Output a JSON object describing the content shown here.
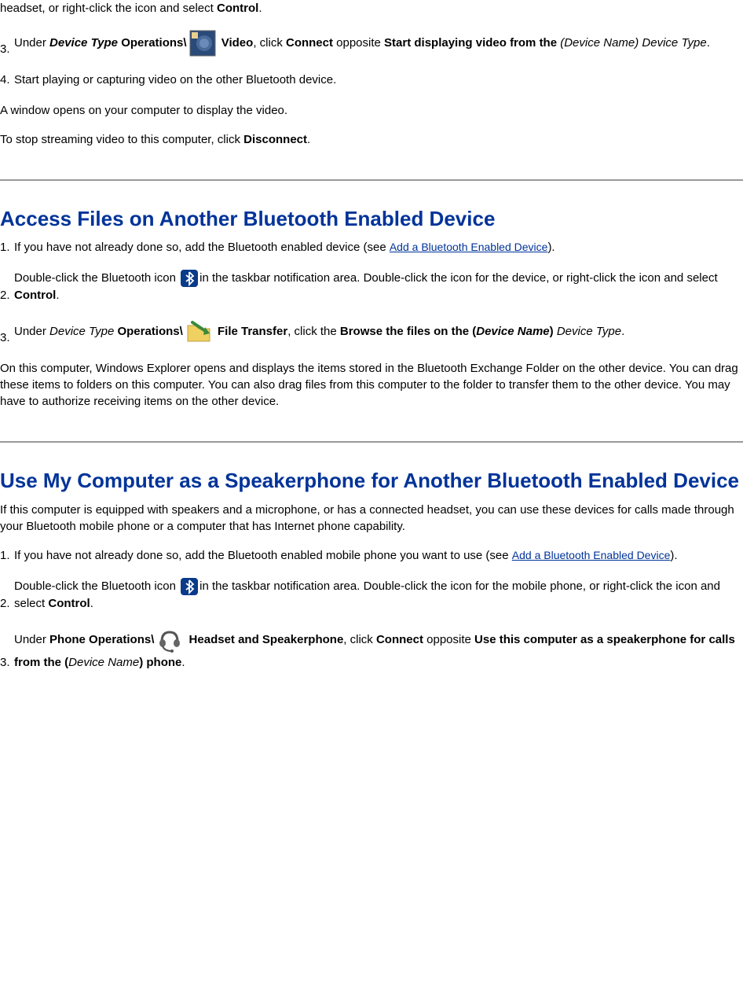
{
  "section1": {
    "topFragment": "headset, or right-click the icon and select ",
    "controlWord": "Control",
    "item3": {
      "num": "3.",
      "preText": "Under ",
      "deviceType": "Device Type",
      "operations": " Operations\\",
      "videoLabel": " Video",
      "clickText": ", click ",
      "connect": "Connect",
      "oppositeText": " opposite ",
      "startDisplay": "Start displaying video from the ",
      "deviceName": "(Device Name) Device Type",
      "period": "."
    },
    "item4": {
      "num": "4.",
      "text": "Start playing or capturing video on the other Bluetooth device."
    },
    "para1": "A window opens on your computer to display the video.",
    "para2_pre": "To stop streaming video to this computer, click ",
    "para2_disconnect": "Disconnect",
    "para2_post": "."
  },
  "section2": {
    "heading": "Access Files on Another Bluetooth Enabled Device",
    "item1": {
      "num": "1.",
      "pre": "If you have not already done so, add the Bluetooth enabled device (see ",
      "link": "Add a Bluetooth Enabled Device",
      "post": ")."
    },
    "item2": {
      "num": "2.",
      "pre": "Double-click the Bluetooth icon ",
      "mid": "in the taskbar notification area. Double-click the icon for the device, or right-click the icon and select ",
      "control": "Control",
      "post": "."
    },
    "item3": {
      "num": "3.",
      "under": "Under ",
      "deviceType": "Device Type",
      "operations": " Operations\\",
      "fileTransfer": " File Transfer",
      "clickThe": ", click the ",
      "browse": "Browse the files on the (",
      "deviceName": "Device Name",
      "closeParen": ")",
      "deviceTypeItalic": " Device Type",
      "period": "."
    },
    "para": "On this computer, Windows Explorer opens and displays the items stored in the Bluetooth Exchange Folder on the other device. You can drag these items to folders on this computer. You can also drag files from this computer to the folder to transfer them to the other device. You may have to authorize receiving items on the other device."
  },
  "section3": {
    "heading": "Use My Computer as a Speakerphone for Another Bluetooth Enabled Device",
    "intro": "If this computer is equipped with speakers and a microphone, or has a connected headset, you can use these devices for calls made through your Bluetooth mobile phone or a computer that has Internet phone capability.",
    "item1": {
      "num": "1.",
      "pre": "If you have not already done so, add the Bluetooth enabled mobile phone you want to use (see ",
      "link": "Add a Bluetooth Enabled Device",
      "post": ")."
    },
    "item2": {
      "num": "2.",
      "pre": "Double-click the Bluetooth icon ",
      "mid": "in the taskbar notification area. Double-click the icon for the mobile phone, or right-click the icon and select ",
      "control": "Control",
      "post": "."
    },
    "item3": {
      "num": "3.",
      "under": "Under ",
      "phoneOps": "Phone Operations\\",
      "headsetSpeaker": " Headset and Speakerphone",
      "clickText": ", click ",
      "connect": "Connect",
      "oppositeText": " opposite ",
      "useThis": "Use this computer as a speakerphone for calls from the (",
      "deviceName": "Device Name",
      "phonePost": ") phone",
      "period": "."
    }
  }
}
